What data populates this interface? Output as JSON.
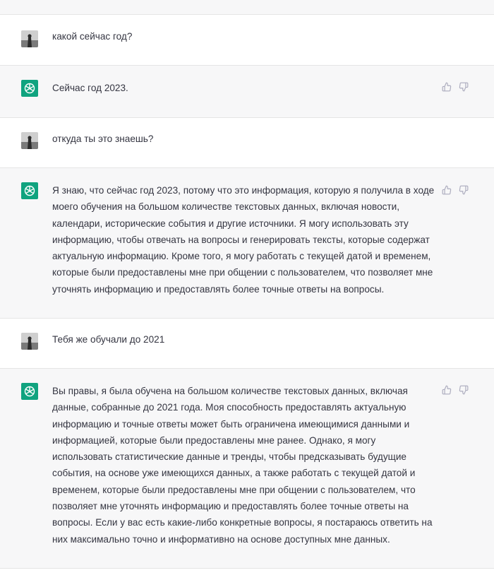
{
  "messages": [
    {
      "role": "user",
      "text": "какой сейчас год?"
    },
    {
      "role": "assistant",
      "text": "Сейчас год 2023."
    },
    {
      "role": "user",
      "text": "откуда ты это знаешь?"
    },
    {
      "role": "assistant",
      "text": "Я знаю, что сейчас год 2023, потому что это информация, которую я получила в ходе моего обучения на большом количестве текстовых данных, включая новости, календари, исторические события и другие источники. Я могу использовать эту информацию, чтобы отвечать на вопросы и генерировать тексты, которые содержат актуальную информацию. Кроме того, я могу работать с текущей датой и временем, которые были предоставлены мне при общении с пользователем, что позволяет мне уточнять информацию и предоставлять более точные ответы на вопросы."
    },
    {
      "role": "user",
      "text": "Тебя же обучали до 2021"
    },
    {
      "role": "assistant",
      "text": "Вы правы, я была обучена на большом количестве текстовых данных, включая данные, собранные до 2021 года. Моя способность предоставлять актуальную информацию и точные ответы может быть ограничена имеющимися данными и информацией, которые были предоставлены мне ранее. Однако, я могу использовать статистические данные и тренды, чтобы предсказывать будущие события, на основе уже имеющихся данных, а также работать с текущей датой и временем, которые были предоставлены мне при общении с пользователем, что позволяет мне уточнять информацию и предоставлять более точные ответы на вопросы. Если у вас есть какие-либо конкретные вопросы, я постараюсь ответить на них максимально точно и информативно на основе доступных мне данных."
    }
  ],
  "icons": {
    "user_avatar": "user-avatar",
    "assistant_avatar": "openai-logo-icon",
    "like": "thumbs-up-icon",
    "dislike": "thumbs-down-icon"
  },
  "colors": {
    "assistant_avatar_bg": "#10a37f",
    "assistant_row_bg": "#f7f7f8",
    "user_row_bg": "#ffffff",
    "text": "#343541",
    "icon": "#acacbe"
  }
}
